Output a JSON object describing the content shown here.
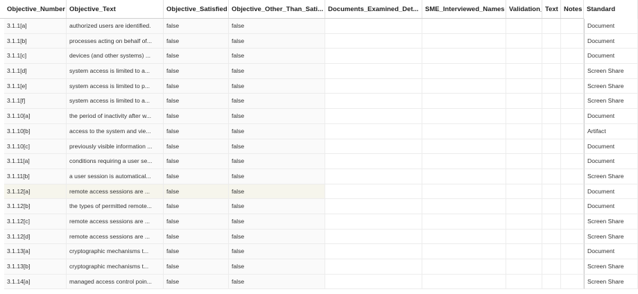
{
  "columns": [
    "Objective_Number",
    "Objective_Text",
    "Objective_Satisfied",
    "Objective_Other_Than_Sati...",
    "Documents_Examined_Det...",
    "SME_Interviewed_Names",
    "Validation_",
    "Text",
    "Notes",
    "Standard"
  ],
  "rows": [
    {
      "num": "3.1.1[a]",
      "text": "authorized users are identified.",
      "sat": "false",
      "other": "false",
      "std": "Document"
    },
    {
      "num": "3.1.1[b]",
      "text": "processes acting on behalf of...",
      "sat": "false",
      "other": "false",
      "std": "Document"
    },
    {
      "num": "3.1.1[c]",
      "text": "devices (and other systems) ...",
      "sat": "false",
      "other": "false",
      "std": "Document"
    },
    {
      "num": "3.1.1[d]",
      "text": "system access is limited to a...",
      "sat": "false",
      "other": "false",
      "std": "Screen Share"
    },
    {
      "num": "3.1.1[e]",
      "text": "system access is limited to p...",
      "sat": "false",
      "other": "false",
      "std": "Screen Share"
    },
    {
      "num": "3.1.1[f]",
      "text": "system access is limited to a...",
      "sat": "false",
      "other": "false",
      "std": "Screen Share"
    },
    {
      "num": "3.1.10[a]",
      "text": "the period of inactivity after w...",
      "sat": "false",
      "other": "false",
      "std": "Document"
    },
    {
      "num": "3.1.10[b]",
      "text": "access to the system and vie...",
      "sat": "false",
      "other": "false",
      "std": "Artifact"
    },
    {
      "num": "3.1.10[c]",
      "text": "previously visible information ...",
      "sat": "false",
      "other": "false",
      "std": "Document"
    },
    {
      "num": "3.1.11[a]",
      "text": "conditions requiring a user se...",
      "sat": "false",
      "other": "false",
      "std": "Document"
    },
    {
      "num": "3.1.11[b]",
      "text": "a user session is automatical...",
      "sat": "false",
      "other": "false",
      "std": "Screen Share"
    },
    {
      "num": "3.1.12[a]",
      "text": "remote access sessions are ...",
      "sat": "false",
      "other": "false",
      "std": "Document"
    },
    {
      "num": "3.1.12[b]",
      "text": "the types of permitted remote...",
      "sat": "false",
      "other": "false",
      "std": "Document"
    },
    {
      "num": "3.1.12[c]",
      "text": "remote access sessions are ...",
      "sat": "false",
      "other": "false",
      "std": "Screen Share"
    },
    {
      "num": "3.1.12[d]",
      "text": "remote access sessions are ...",
      "sat": "false",
      "other": "false",
      "std": "Screen Share"
    },
    {
      "num": "3.1.13[a]",
      "text": "cryptographic mechanisms t...",
      "sat": "false",
      "other": "false",
      "std": "Document"
    },
    {
      "num": "3.1.13[b]",
      "text": "cryptographic mechanisms t...",
      "sat": "false",
      "other": "false",
      "std": "Screen Share"
    },
    {
      "num": "3.1.14[a]",
      "text": "managed access control poin...",
      "sat": "false",
      "other": "false",
      "std": "Screen Share"
    }
  ],
  "highlighted_row": 11
}
